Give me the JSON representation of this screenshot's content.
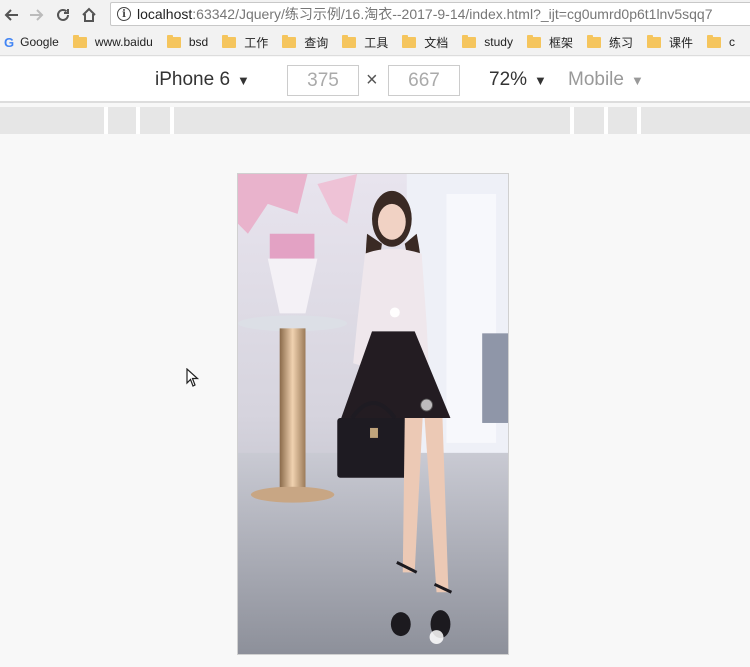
{
  "browser": {
    "url_host": "localhost",
    "url_path": ":63342/Jquery/练习示例/16.淘衣--2017-9-14/index.html?_ijt=cg0umrd0p6t1lnv5sqq7"
  },
  "bookmarks": [
    {
      "label": "Google",
      "icon": "google-icon"
    },
    {
      "label": "www.baidu",
      "icon": "folder-icon"
    },
    {
      "label": "bsd",
      "icon": "folder-icon"
    },
    {
      "label": "工作",
      "icon": "folder-icon"
    },
    {
      "label": "查询",
      "icon": "folder-icon"
    },
    {
      "label": "工具",
      "icon": "folder-icon"
    },
    {
      "label": "文档",
      "icon": "folder-icon"
    },
    {
      "label": "study",
      "icon": "folder-icon"
    },
    {
      "label": "框架",
      "icon": "folder-icon"
    },
    {
      "label": "练习",
      "icon": "folder-icon"
    },
    {
      "label": "课件",
      "icon": "folder-icon"
    },
    {
      "label": "c",
      "icon": "folder-icon"
    }
  ],
  "device_toolbar": {
    "device": "iPhone 6",
    "width": "375",
    "height": "667",
    "times": "×",
    "zoom": "72%",
    "mode": "Mobile"
  },
  "viewport": {
    "photo_icon": "fashion-photo"
  }
}
